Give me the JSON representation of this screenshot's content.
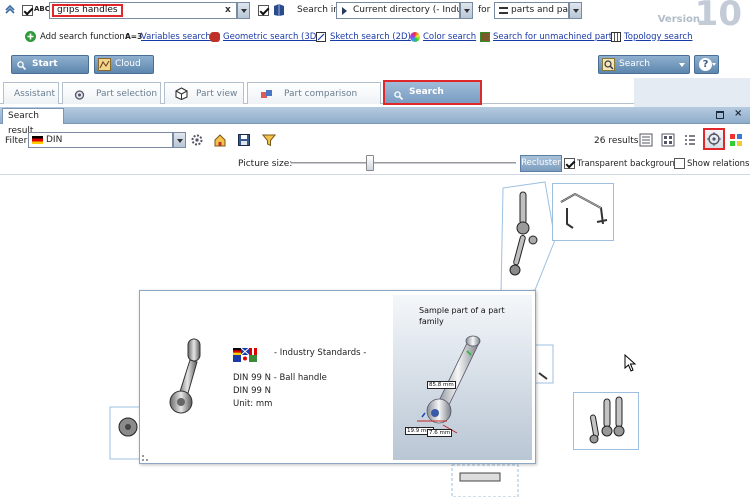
{
  "search_bar": {
    "abc_label": "ABC",
    "query": "grips handles",
    "clear_label": "x",
    "search_in_label": "Search in",
    "search_in_value": "Current directory (- Industr",
    "for_label": "for",
    "for_value": "parts and part",
    "version_label": "Version",
    "version_number": "10"
  },
  "add_search": {
    "label": "Add search function:",
    "var_prefix": "A=3",
    "functions": [
      "Variables search",
      "Geometric search (3D)",
      "Sketch search (2D)",
      "Color search",
      "Search for unmachined parts",
      "Topology search"
    ]
  },
  "toolbar": {
    "start_search": "Start search",
    "cloud_map": "Cloud Map",
    "search_templates": "Search templates"
  },
  "tabs": [
    "Assistant",
    "Part selection",
    "Part view",
    "Part comparison",
    "Search results"
  ],
  "panel": {
    "title": "Search result",
    "filter_label": "Filter:",
    "filter_value": "DIN",
    "results_count": "26 results",
    "picture_size_label": "Picture size:",
    "recluster_label": "Recluster",
    "transparent_bg_label": "Transparent background",
    "show_relations_label": "Show relations"
  },
  "popup": {
    "category": "- Industry Standards -",
    "part_title": "DIN 99 N - Ball handle",
    "part_standard": "DIN 99 N",
    "unit": "Unit: mm",
    "sample_text": "Sample part of a part family",
    "dim_1": "85.8 mm",
    "dim_2": "19.9 mm",
    "dim_3": "7.6 mm"
  },
  "colors": {
    "accent_red": "#e0282a",
    "button_blue": "#5d86ad",
    "active_tab": "#7a9dc2",
    "link_blue": "#1a3aa8"
  }
}
